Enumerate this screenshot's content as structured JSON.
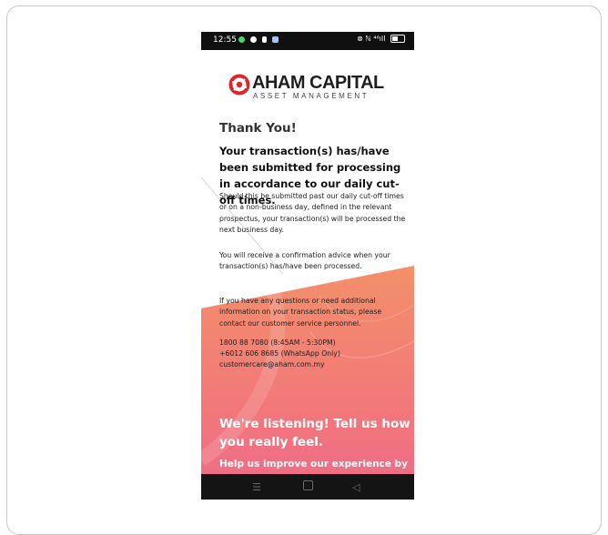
{
  "status_bar": {
    "time": "12:55",
    "right_indicators": "⊗ ℕ ⁴⁶ıll",
    "icons": [
      "whatsapp-icon",
      "messenger-icon",
      "notification-icon",
      "gallery-icon"
    ]
  },
  "brand": {
    "name": "AHAM CAPITAL",
    "tagline": "ASSET MANAGEMENT",
    "accent_color": "#e0242c"
  },
  "confirmation": {
    "title": "Thank You!",
    "headline": "Your transaction(s) has/have been submitted for processing in accordance to our daily cut-off times.",
    "cutoff_note": "Should this be submitted past our daily cut-off times or on a non-business day, defined in the relevant prospectus, your transaction(s) will be processed the next business day.",
    "advice_note": "You will receive a confirmation advice when your transaction(s) has/have been processed.",
    "help_note": "If you have any questions or need additional information on your transaction status, please contact our customer service personnel."
  },
  "contact": {
    "phone": "1800 88 7080 (8:45AM - 5:30PM)",
    "whatsapp": "+6012 606 8685 (WhatsApp Only)",
    "email": "customercare@aham.com.my"
  },
  "feedback": {
    "heading": "We're listening! Tell us how you really feel.",
    "subheading": "Help us improve our experience by"
  },
  "colors": {
    "gradient_top": "#f28a67",
    "gradient_bottom": "#f06b85"
  },
  "nav_bar": {
    "menu_icon": "menu-icon",
    "home_icon": "home-icon",
    "back_icon": "back-icon"
  }
}
